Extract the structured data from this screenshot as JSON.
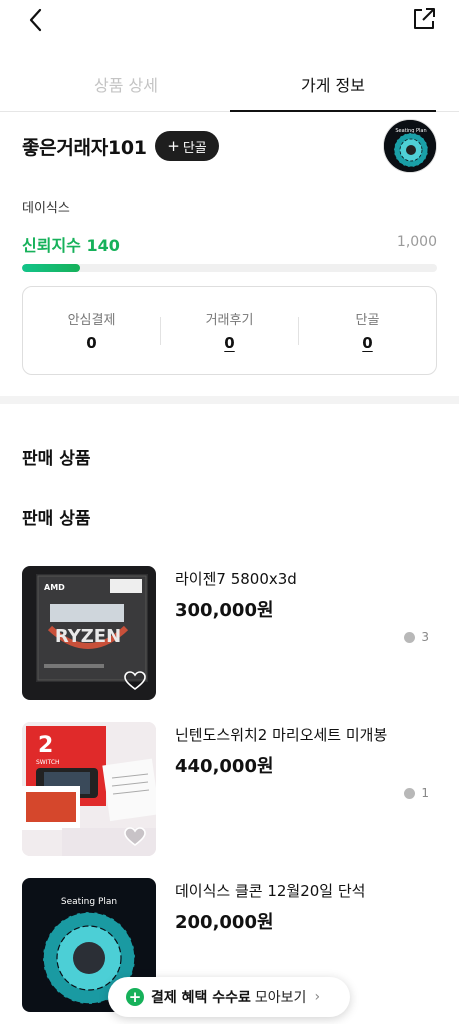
{
  "tabs": [
    {
      "label": "상품 상세",
      "active": false
    },
    {
      "label": "가게 정보",
      "active": true
    }
  ],
  "seller": {
    "name": "좋은거래자101",
    "follow_label": "단골",
    "avatar_text": "Seating Plan"
  },
  "shop": {
    "description": "데이식스",
    "trust_label": "신뢰지수 140",
    "trust_value": 140,
    "trust_max": "1,000",
    "trust_color": "#16b15a"
  },
  "stats": [
    {
      "label": "안심결제",
      "value": "0",
      "underline": false
    },
    {
      "label": "거래후기",
      "value": "0",
      "underline": true
    },
    {
      "label": "단골",
      "value": "0",
      "underline": true
    }
  ],
  "sections": {
    "heading1": "판매 상품",
    "heading2": "판매 상품"
  },
  "products": [
    {
      "title": "라이젠7 5800x3d",
      "price": "300,000원",
      "chats": "3",
      "thumb": "ryzen-box"
    },
    {
      "title": "닌텐도스위치2 마리오세트 미개봉",
      "price": "440,000원",
      "chats": "1",
      "thumb": "switch-box"
    },
    {
      "title": "데이식스 클콘 12월20일 단석",
      "price": "200,000원",
      "chats": "",
      "thumb": "seating-plan"
    }
  ],
  "thumb_text": {
    "amd": "AMD",
    "ryzen": "RYZEN",
    "switch": "2",
    "switch_small": "SWITCH",
    "seating_plan": "Seating Plan"
  },
  "fee_banner": {
    "icon": "plus-circle-icon",
    "bold": "결제 혜택 수수료",
    "regular": "모아보기"
  }
}
